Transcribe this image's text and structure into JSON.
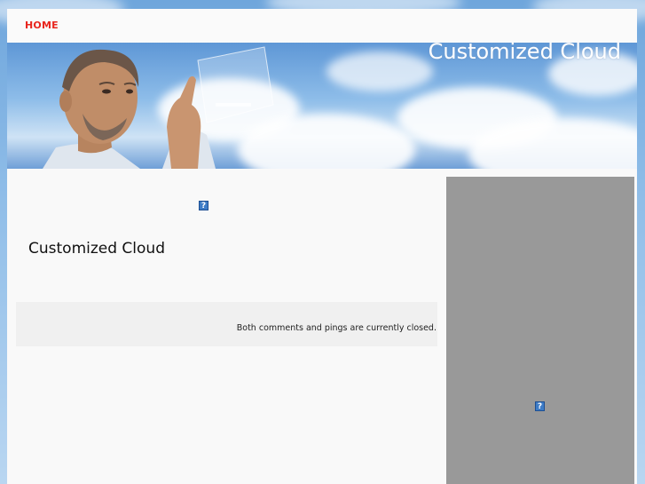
{
  "nav": {
    "home_label": "HOME"
  },
  "banner": {
    "title": "Customized Cloud",
    "image": "man-touching-cloud-screen"
  },
  "post": {
    "title": "Customized Cloud",
    "icon": "broken-image-icon"
  },
  "meta": {
    "text": "Both comments and pings are currently closed."
  },
  "sidebar": {
    "icon": "broken-image-icon"
  },
  "colors": {
    "nav_link": "#e8251d",
    "sidebar_bg": "#999999",
    "page_bg": "#f9f9f9"
  }
}
